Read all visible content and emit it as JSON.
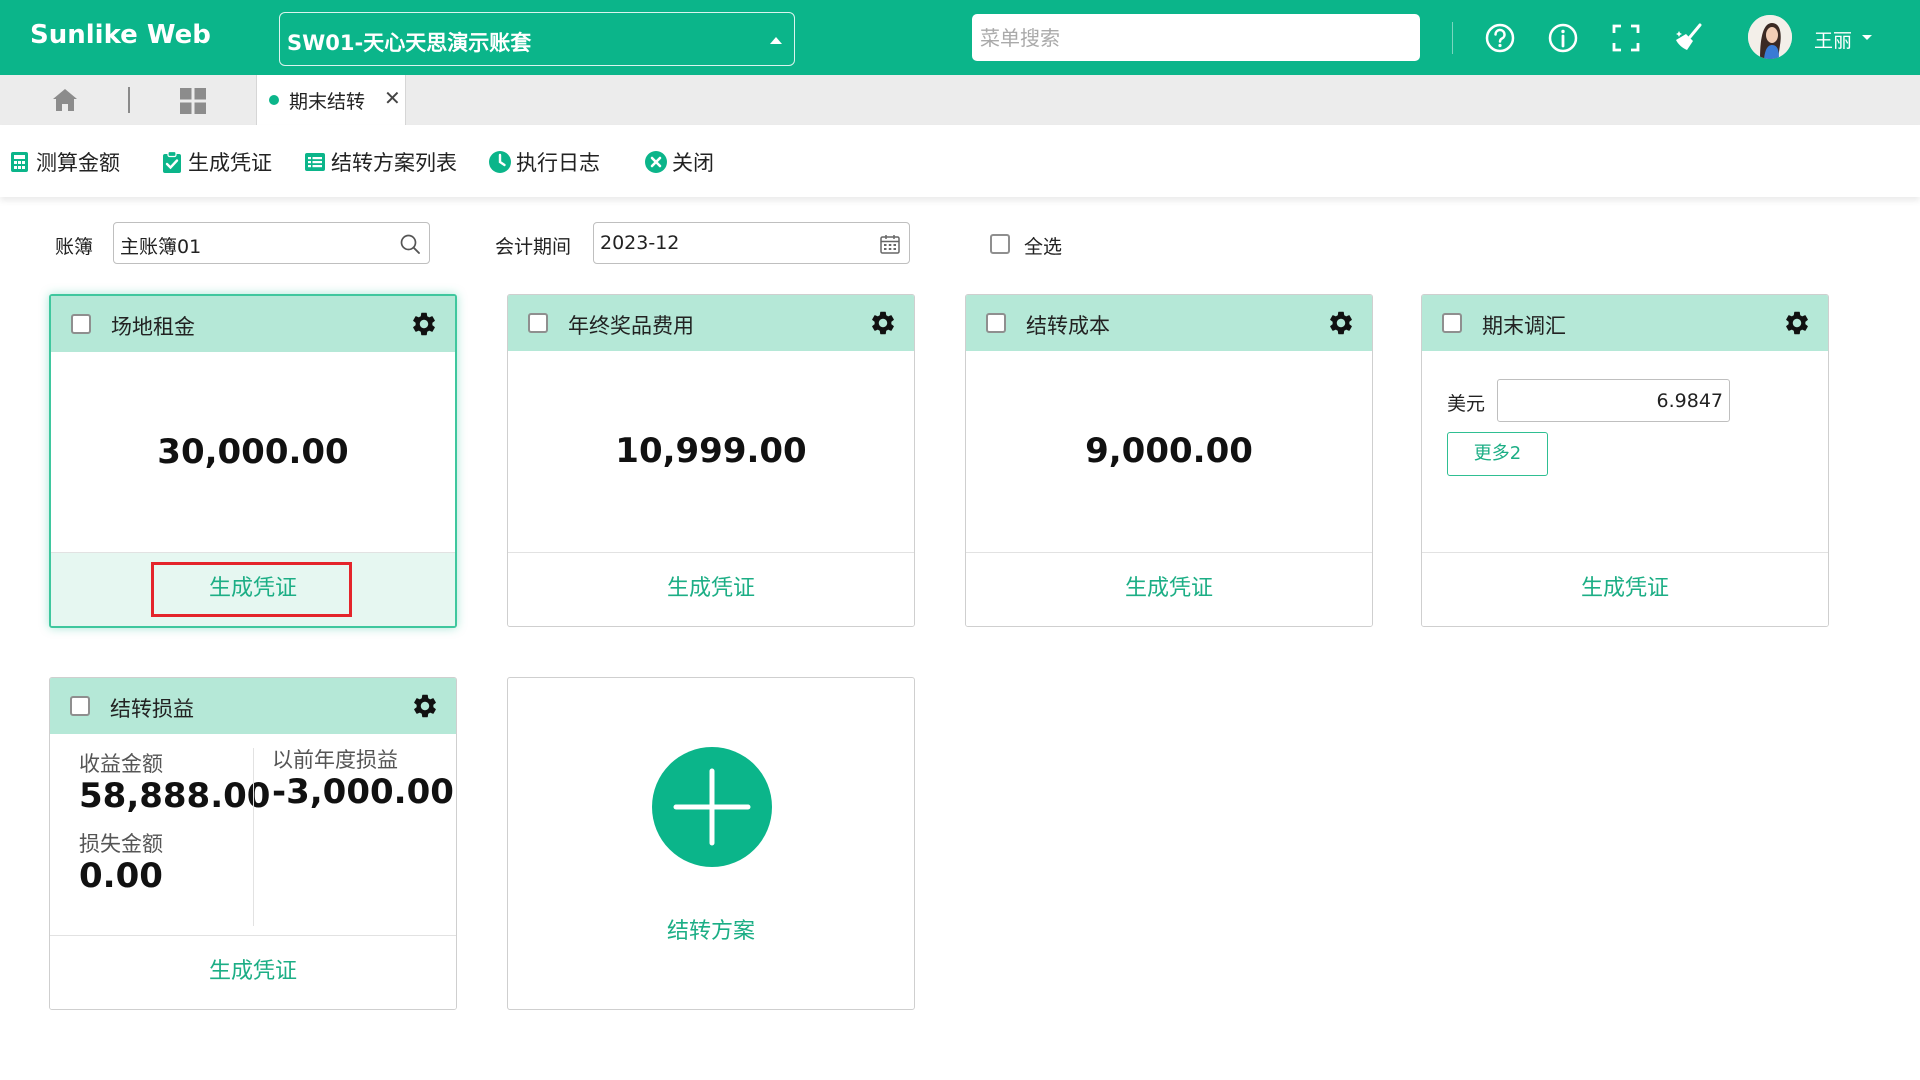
{
  "app": {
    "brand": "Sunlike Web",
    "account_set": "SW01-天心天思演示账套",
    "menu_search_placeholder": "菜单搜索",
    "user_name": "王丽"
  },
  "tabs": {
    "active_label": "期末结转"
  },
  "toolbar": {
    "calc": "测算金额",
    "gen_voucher": "生成凭证",
    "plan_list": "结转方案列表",
    "exec_log": "执行日志",
    "close": "关闭"
  },
  "filters": {
    "ledger_label": "账簿",
    "ledger_value": "主账簿01",
    "period_label": "会计期间",
    "period_value": "2023-12",
    "select_all": "全选"
  },
  "cards": [
    {
      "title": "场地租金",
      "amount": "30,000.00",
      "action": "生成凭证"
    },
    {
      "title": "年终奖品费用",
      "amount": "10,999.00",
      "action": "生成凭证"
    },
    {
      "title": "结转成本",
      "amount": "9,000.00",
      "action": "生成凭证"
    },
    {
      "title": "期末调汇",
      "currency_label": "美元",
      "rate": "6.9847",
      "more": "更多2",
      "action": "生成凭证"
    },
    {
      "title": "结转损益",
      "income_label": "收益金额",
      "income_value": "58,888.00",
      "loss_label": "损失金额",
      "loss_value": "0.00",
      "prior_label": "以前年度损益",
      "prior_value": "-3,000.00",
      "action": "生成凭证"
    }
  ],
  "add_plan": {
    "label": "结转方案"
  },
  "colors": {
    "brand": "#0bb58a",
    "header_tint": "#b5e8d7",
    "highlight": "#e4252b"
  }
}
